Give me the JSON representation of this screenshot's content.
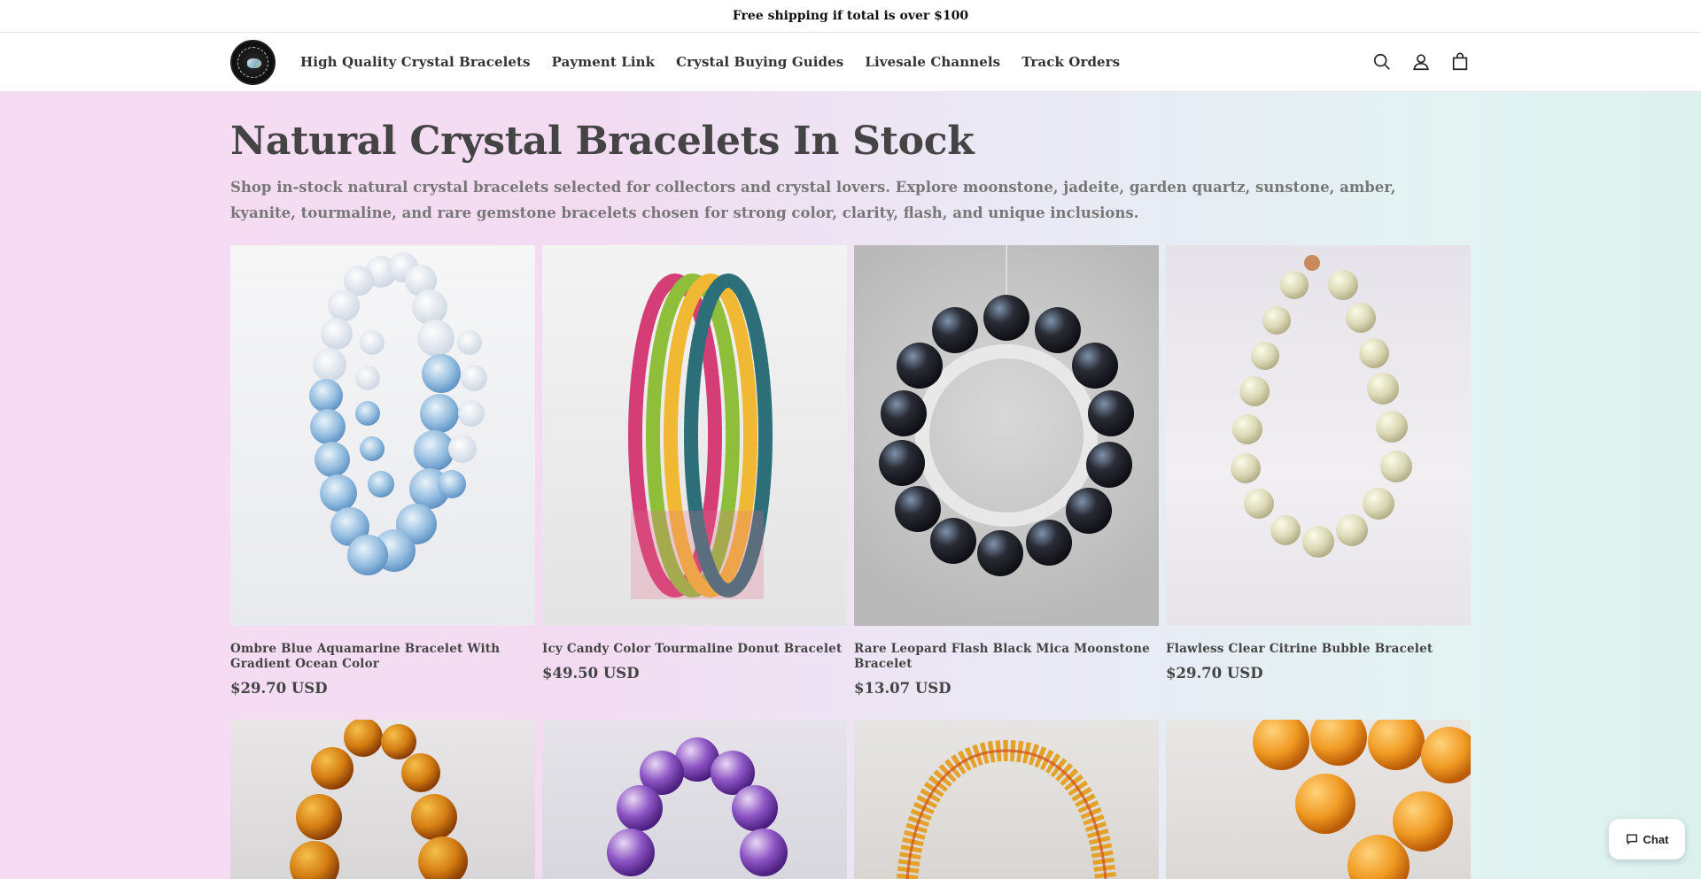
{
  "announcement": "Free shipping if total is over $100",
  "header": {
    "logo_alt": "logo",
    "nav": [
      {
        "label": "High Quality Crystal Bracelets"
      },
      {
        "label": "Payment Link"
      },
      {
        "label": "Crystal Buying Guides"
      },
      {
        "label": "Livesale Channels"
      },
      {
        "label": "Track Orders"
      }
    ],
    "icons": [
      "search-icon",
      "account-icon",
      "cart-icon"
    ]
  },
  "collection": {
    "title": "Natural Crystal Bracelets In Stock",
    "description": "Shop in-stock natural crystal bracelets selected for collectors and crystal lovers. Explore moonstone, jadeite, garden quartz, sunstone, amber, kyanite, tourmaline, and rare gemstone bracelets chosen for strong color, clarity, flash, and unique inclusions."
  },
  "products": [
    {
      "title": "Ombre Blue Aquamarine Bracelet With Gradient Ocean Color",
      "price": "$29.70 USD"
    },
    {
      "title": "Icy Candy Color Tourmaline Donut Bracelet",
      "price": "$49.50 USD"
    },
    {
      "title": "Rare Leopard Flash Black Mica Moonstone Bracelet",
      "price": "$13.07 USD"
    },
    {
      "title": "Flawless Clear Citrine Bubble Bracelet",
      "price": "$29.70 USD"
    }
  ],
  "chat": {
    "label": "Chat"
  }
}
